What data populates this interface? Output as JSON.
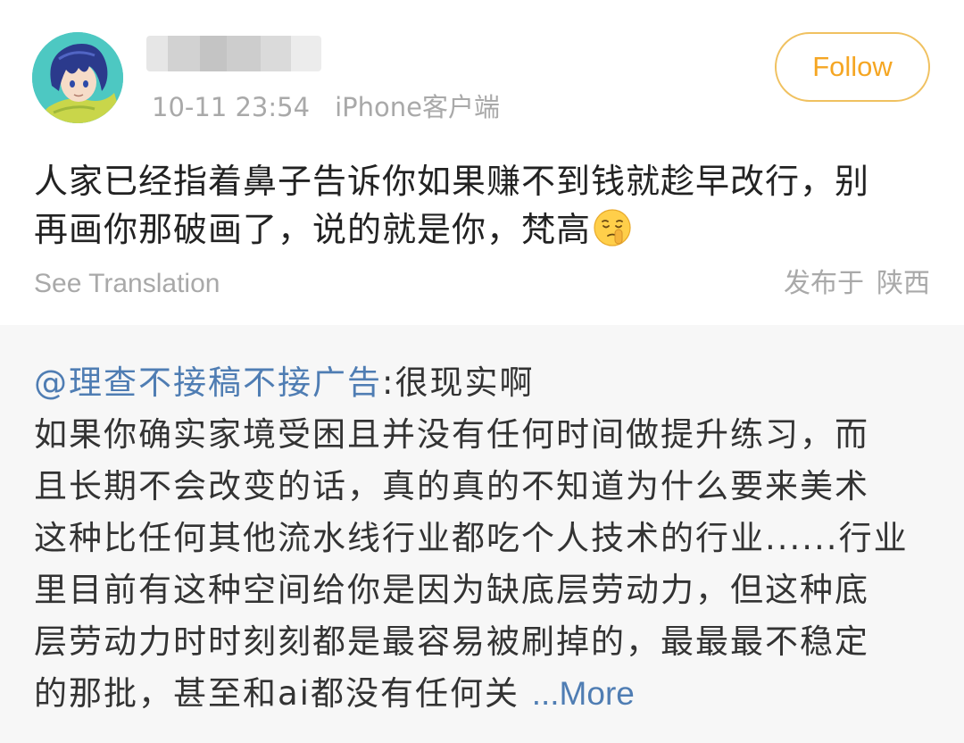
{
  "post": {
    "timestamp": "10-11 23:54",
    "client": "iPhone客户端",
    "follow_label": "Follow",
    "body_lines": [
      "人家已经指着鼻子告诉你如果赚不到钱就趁早改行，别",
      "再画你那破画了，说的就是你，梵高"
    ],
    "emoji_icon": "shush-face-emoji",
    "see_translation": "See Translation",
    "location_label": "发布于",
    "location": "陕西"
  },
  "repost": {
    "mention": "@理查不接稿不接广告",
    "first_line_rest": ":很现实啊",
    "lines": [
      "如果你确实家境受困且并没有任何时间做提升练习，而",
      "且长期不会改变的话，真的真的不知道为什么要来美术",
      "这种比任何其他流水线行业都吃个人技术的行业......行业",
      "里目前有这种空间给你是因为缺底层劳动力，但这种底",
      "层劳动力时时刻刻都是最容易被刷掉的，最最最不稳定"
    ],
    "last_line_text": "的那批，甚至和ai都没有任何关 ",
    "more_label": "...More"
  },
  "colors": {
    "follow_accent": "#f5a623",
    "follow_border": "#f0c160",
    "link": "#4f7db3",
    "meta_gray": "#a9a9a9",
    "repost_bg": "#f7f7f7"
  }
}
